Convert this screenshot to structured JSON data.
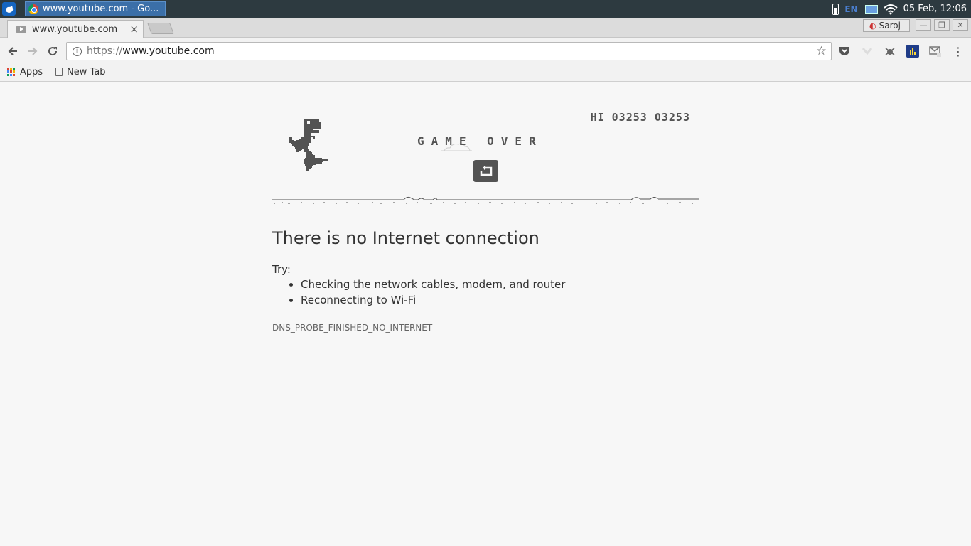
{
  "taskbar": {
    "os_menu_icon": "xfce-mouse-icon",
    "task_title": "www.youtube.com - Go...",
    "language": "EN",
    "clock": "05 Feb, 12:06"
  },
  "browser": {
    "tab_title": "www.youtube.com",
    "tab_close": "×",
    "profile_name": "Saroj",
    "url_scheme": "https://",
    "url_host": "www.youtube.com",
    "bookmarks": [
      {
        "label": "Apps"
      },
      {
        "label": "New Tab"
      }
    ]
  },
  "game": {
    "score_label": "HI 03253 03253",
    "game_over": "GAME OVER"
  },
  "error": {
    "title": "There is no Internet connection",
    "try_label": "Try:",
    "suggestions": [
      "Checking the network cables, modem, and router",
      "Reconnecting to Wi-Fi"
    ],
    "code": "DNS_PROBE_FINISHED_NO_INTERNET"
  },
  "colors": {
    "taskbar_bg": "#2d3a40",
    "page_bg": "#f7f7f7",
    "game_gray": "#535353",
    "active_task": "#3b6fa8"
  }
}
